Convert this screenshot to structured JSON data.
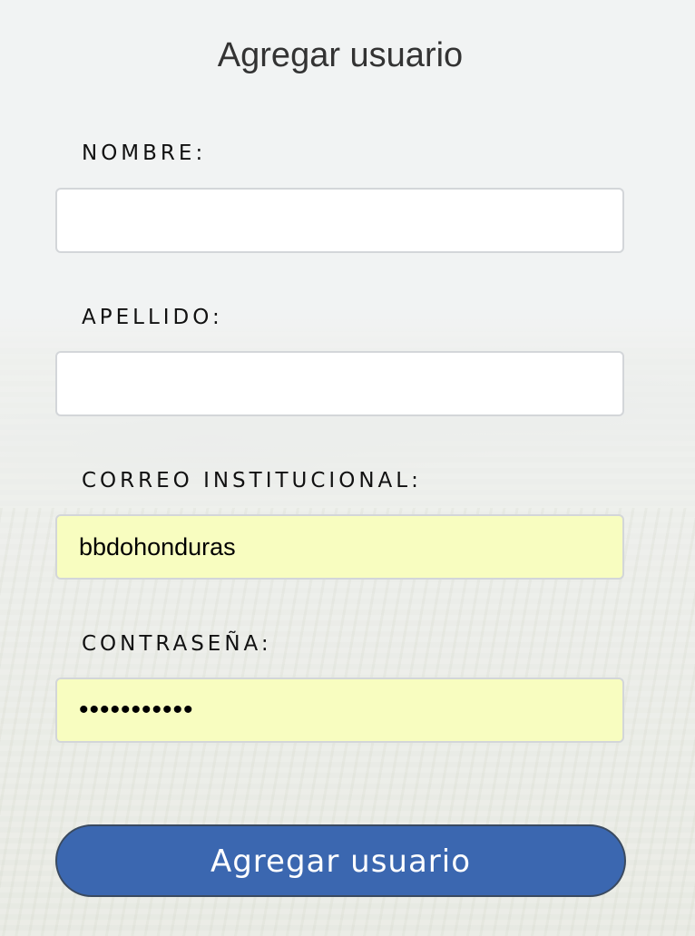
{
  "form": {
    "title": "Agregar usuario",
    "fields": [
      {
        "label": "NOMBRE:",
        "value": "",
        "type": "text"
      },
      {
        "label": "APELLIDO:",
        "value": "",
        "type": "text"
      },
      {
        "label": "CORREO INSTITUCIONAL:",
        "value": "bbdohonduras",
        "type": "text"
      },
      {
        "label": "CONTRASEÑA:",
        "value": "•••••••••••",
        "type": "password"
      }
    ],
    "submit_label": "Agregar usuario"
  },
  "colors": {
    "autofill_bg": "#f8fdc0",
    "button_bg": "#3b67b0",
    "button_text": "#ffffff"
  }
}
